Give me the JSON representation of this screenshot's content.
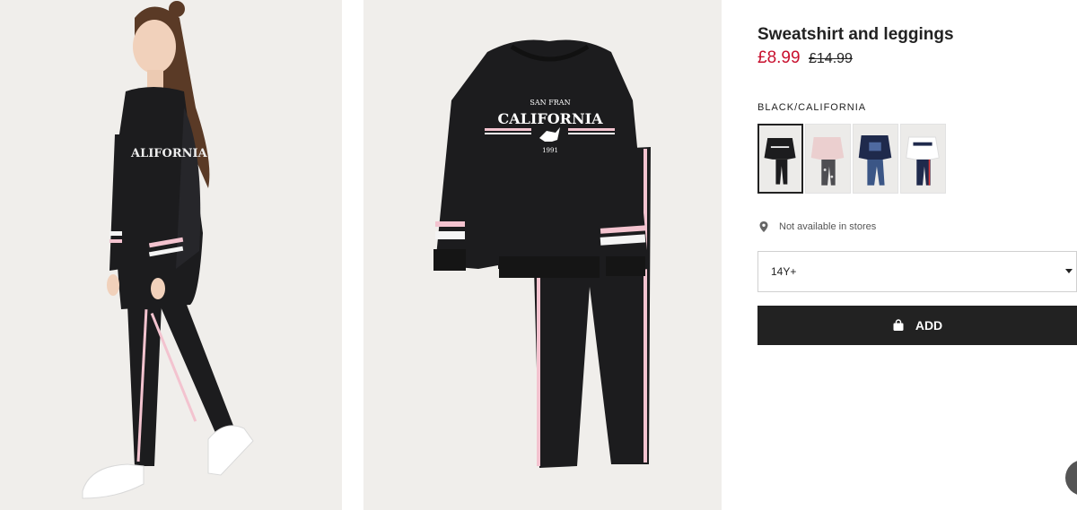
{
  "product": {
    "title": "Sweatshirt and leggings",
    "price_sale": "£8.99",
    "price_old": "£14.99",
    "color_label": "BLACK/CALIFORNIA"
  },
  "swatches": [
    {
      "icon": "black-california-outfit",
      "selected": true
    },
    {
      "icon": "pink-floral-outfit",
      "selected": false
    },
    {
      "icon": "navy-print-outfit",
      "selected": false
    },
    {
      "icon": "white-navy-outfit",
      "selected": false
    }
  ],
  "availability": {
    "text": "Not available in stores",
    "icon": "location-pin-icon"
  },
  "size_select": {
    "value": "14Y+"
  },
  "add_button": {
    "label": "ADD",
    "icon": "shopping-bag-icon"
  },
  "garment_print": {
    "line1": "SAN FRAN",
    "line2": "CALIFORNIA",
    "line3": "1991"
  },
  "colors": {
    "sale": "#c8102e",
    "button": "#222222",
    "garment": "#1c1c1e",
    "stripe_pink": "#f3c3cf",
    "image_bg": "#f0eeeb"
  }
}
